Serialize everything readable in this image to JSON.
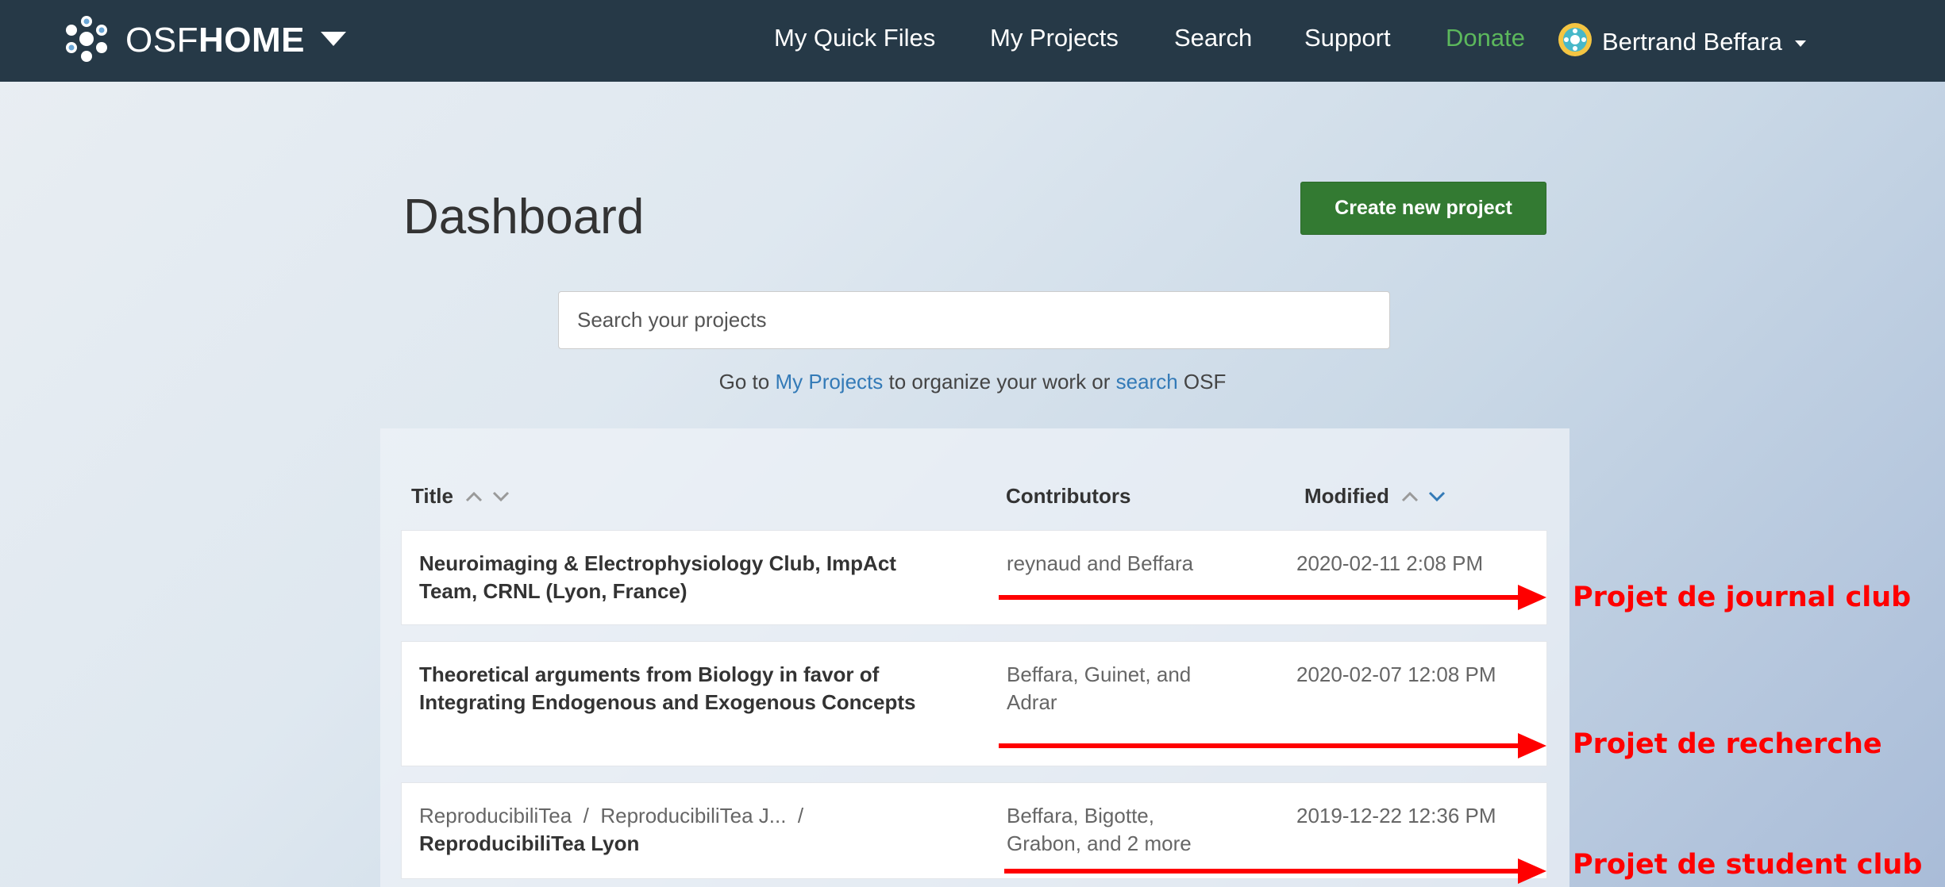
{
  "navbar": {
    "brand_prefix": "OSF",
    "brand_suffix": "HOME",
    "links": {
      "quick_files": "My Quick Files",
      "projects": "My Projects",
      "search": "Search",
      "support": "Support",
      "donate": "Donate"
    },
    "user_name": "Bertrand Beffara"
  },
  "dashboard": {
    "title": "Dashboard",
    "create_button": "Create new project",
    "search_placeholder": "Search your projects",
    "helper_prefix": "Go to ",
    "helper_link_projects": "My Projects",
    "helper_middle": " to organize your work or ",
    "helper_link_search": "search",
    "helper_suffix": " OSF"
  },
  "table": {
    "headers": {
      "title": "Title",
      "contributors": "Contributors",
      "modified": "Modified"
    },
    "rows": [
      {
        "title": "Neuroimaging & Electrophysiology Club, ImpAct Team, CRNL (Lyon, France)",
        "contributors": "reynaud and Beffara",
        "modified": "2020-02-11 2:08 PM"
      },
      {
        "title": "Theoretical arguments from Biology in favor of Integrating Endogenous and Exogenous Concepts",
        "contributors": "Beffara, Guinet, and Adrar",
        "modified": "2020-02-07 12:08 PM"
      },
      {
        "breadcrumb": "ReproducibiliTea  /  ReproducibiliTea J...  /",
        "title": "ReproducibiliTea Lyon",
        "contributors": "Beffara, Bigotte, Grabon, and 2 more",
        "modified": "2019-12-22 12:36 PM"
      }
    ]
  },
  "annotations": [
    "Projet de journal club",
    "Projet de recherche",
    "Projet de student club"
  ],
  "colors": {
    "navbar": "#263947",
    "create_button": "#337a32",
    "donate": "#5cb85c",
    "link": "#337ab7",
    "annotation": "#ff0000"
  }
}
